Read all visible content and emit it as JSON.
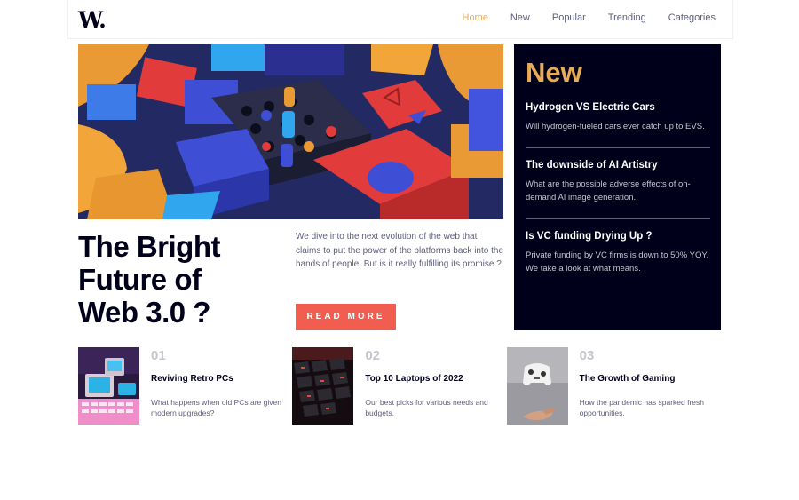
{
  "brand": {
    "logo": "W."
  },
  "nav": [
    "Home",
    "New",
    "Popular",
    "Trending",
    "Categories"
  ],
  "hero": {
    "headline_lines": [
      "The Bright",
      "Future of",
      "Web 3.0 ?"
    ],
    "intro": "We dive into the next evolution of the web that claims to put the power of the platforms back into the hands of people. But is it really fulfilling its promise ?",
    "cta": "READ MORE"
  },
  "new_panel": {
    "title": "New",
    "items": [
      {
        "title": "Hydrogen VS Electric Cars",
        "desc": "Will hydrogen-fueled cars ever catch up to EVS."
      },
      {
        "title": "The downside of AI Artistry",
        "desc": "What are the possible adverse effects of on-demand AI image generation."
      },
      {
        "title": "Is VC funding Drying Up ?",
        "desc": "Private funding by VC firms is down to 50% YOY. We take a look at what means."
      }
    ]
  },
  "cards": [
    {
      "num": "01",
      "title": "Reviving Retro PCs",
      "desc": "What happens when old PCs are given modern upgrades?"
    },
    {
      "num": "02",
      "title": "Top 10 Laptops of 2022",
      "desc": "Our best picks for various needs and budgets."
    },
    {
      "num": "03",
      "title": "The Growth of Gaming",
      "desc": "How the pandemic has sparked fresh opportunities."
    }
  ],
  "colors": {
    "accent": "#e9ab53",
    "cta": "#f15e50",
    "dark": "#00001a",
    "muted": "#5d5f79"
  }
}
